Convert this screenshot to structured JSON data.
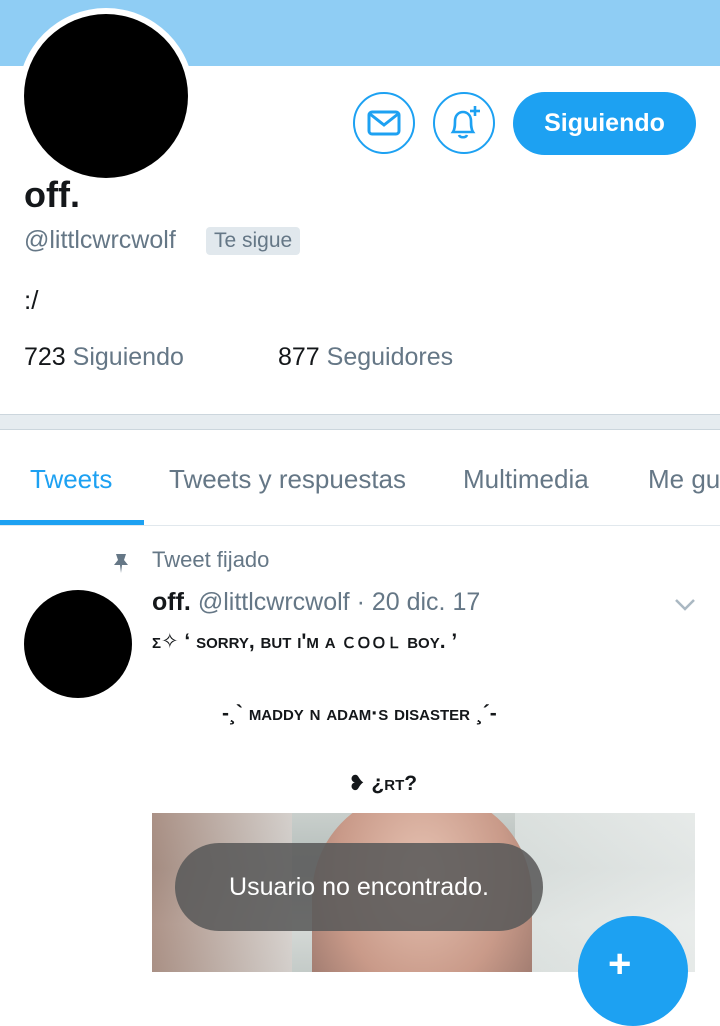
{
  "profile": {
    "name": "off.",
    "handle": "@littlcwrcwolf",
    "follows_you_badge": "Te sigue",
    "bio": ":/",
    "following_count": "723",
    "following_label": "Siguiendo",
    "followers_count": "877",
    "followers_label": "Seguidores"
  },
  "actions": {
    "message_icon": "envelope-icon",
    "notify_icon": "bell-plus-icon",
    "follow_button_label": "Siguiendo"
  },
  "tabs": [
    {
      "label": "Tweets",
      "active": true
    },
    {
      "label": "Tweets y respuestas",
      "active": false
    },
    {
      "label": "Multimedia",
      "active": false
    },
    {
      "label": "Me gu",
      "active": false
    }
  ],
  "pinned_tweet": {
    "pinned_label": "Tweet fijado",
    "author_name": "off.",
    "author_handle": "@littlcwrcwolf",
    "separator": "·",
    "date": "20 dic. 17",
    "line1": "ʃ✧ ‘ sorry, but i'm a ｃｏｏｌ boy. ’",
    "line2": "-¸` maddy n adam·s disaster ¸´-",
    "line3": "❥ ¿rt?"
  },
  "toast": {
    "message": "Usuario no encontrado."
  },
  "compose_fab": {
    "icon": "compose-quill-icon",
    "label": "+"
  },
  "colors": {
    "accent": "#1da1f2",
    "banner": "#8fcdf4",
    "secondary_text": "#657786"
  }
}
